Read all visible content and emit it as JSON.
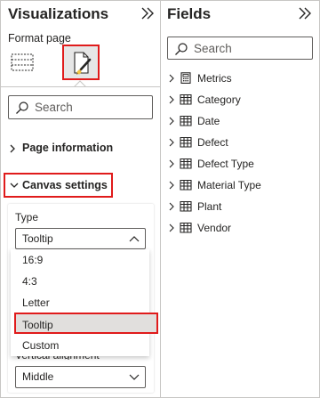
{
  "colors": {
    "highlight": "#e01b1b",
    "border": "#c8c6c4",
    "text": "#252423",
    "selected_bg": "#e1dfdd"
  },
  "visualizations": {
    "title": "Visualizations",
    "format_label": "Format page",
    "icons": [
      "table-format-icon",
      "paintbrush-icon"
    ],
    "search_placeholder": "Search",
    "page_information": "Page information",
    "canvas_settings": "Canvas settings",
    "type_label": "Type",
    "type_value": "Tooltip",
    "options": [
      "16:9",
      "4:3",
      "Letter",
      "Tooltip",
      "Custom"
    ],
    "selected_option": "Tooltip",
    "vertical_alignment_label": "Vertical alignment",
    "vertical_alignment_value": "Middle"
  },
  "fields": {
    "title": "Fields",
    "search_placeholder": "Search",
    "items": [
      {
        "label": "Metrics",
        "icon": "calculator-icon"
      },
      {
        "label": "Category",
        "icon": "table-icon"
      },
      {
        "label": "Date",
        "icon": "table-icon"
      },
      {
        "label": "Defect",
        "icon": "table-icon"
      },
      {
        "label": "Defect Type",
        "icon": "table-icon"
      },
      {
        "label": "Material Type",
        "icon": "table-icon"
      },
      {
        "label": "Plant",
        "icon": "table-icon"
      },
      {
        "label": "Vendor",
        "icon": "table-icon"
      }
    ]
  }
}
